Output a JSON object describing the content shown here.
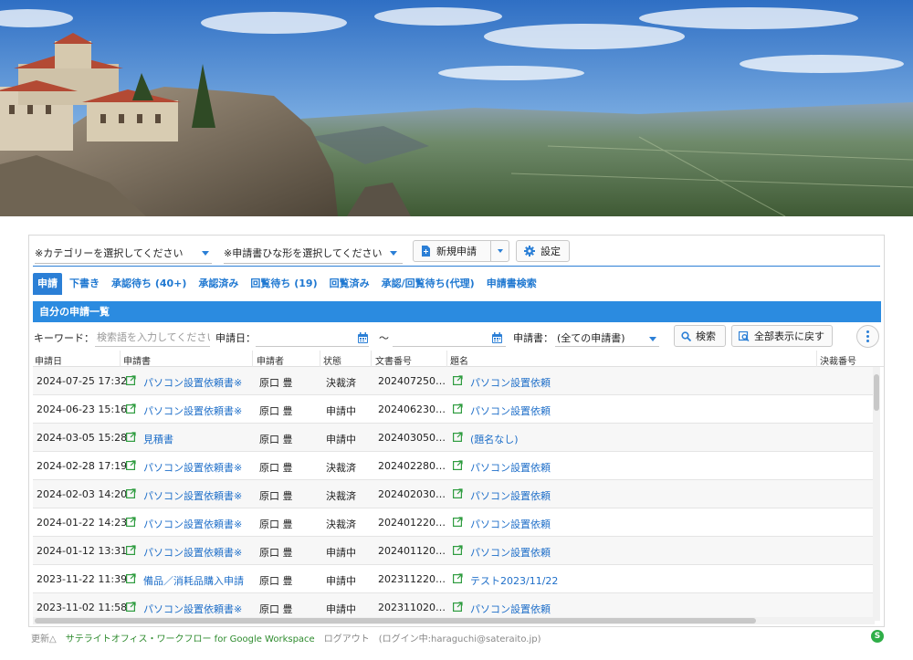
{
  "toolbar": {
    "category_select": "※カテゴリーを選択してください",
    "template_select": "※申請書ひな形を選択してください",
    "new_button": "新規申請",
    "settings_button": "設定"
  },
  "tabs": [
    {
      "label": "申請"
    },
    {
      "label": "下書き"
    },
    {
      "label": "承認待ち (40+)"
    },
    {
      "label": "承認済み"
    },
    {
      "label": "回覧待ち (19)"
    },
    {
      "label": "回覧済み"
    },
    {
      "label": "承認/回覧待ち(代理)"
    },
    {
      "label": "申請書検索"
    }
  ],
  "list_title": "自分の申請一覧",
  "filter": {
    "keyword_label": "キーワード：",
    "keyword_placeholder": "検索語を入力してください",
    "date_label": "申請日：",
    "date_sep": "〜",
    "form_label": "申請書：",
    "form_value": "(全ての申請書)",
    "search_button": "検索",
    "show_all_button": "全部表示に戻す"
  },
  "columns": [
    "申請日",
    "申請書",
    "申請者",
    "状態",
    "文書番号",
    "題名",
    "決裁番号"
  ],
  "rows": [
    {
      "date": "2024-07-25 17:32",
      "form": "パソコン設置依頼書※",
      "user": "原口 豊",
      "status": "決裁済",
      "docno": "202407250…",
      "title": "パソコン設置依頼"
    },
    {
      "date": "2024-06-23 15:16",
      "form": "パソコン設置依頼書※",
      "user": "原口 豊",
      "status": "申請中",
      "docno": "202406230…",
      "title": "パソコン設置依頼"
    },
    {
      "date": "2024-03-05 15:28",
      "form": "見積書",
      "user": "原口 豊",
      "status": "申請中",
      "docno": "202403050…",
      "title": "(題名なし)"
    },
    {
      "date": "2024-02-28 17:19",
      "form": "パソコン設置依頼書※",
      "user": "原口 豊",
      "status": "決裁済",
      "docno": "202402280…",
      "title": "パソコン設置依頼"
    },
    {
      "date": "2024-02-03 14:20",
      "form": "パソコン設置依頼書※",
      "user": "原口 豊",
      "status": "決裁済",
      "docno": "202402030…",
      "title": "パソコン設置依頼"
    },
    {
      "date": "2024-01-22 14:23",
      "form": "パソコン設置依頼書※",
      "user": "原口 豊",
      "status": "決裁済",
      "docno": "202401220…",
      "title": "パソコン設置依頼"
    },
    {
      "date": "2024-01-12 13:31",
      "form": "パソコン設置依頼書※",
      "user": "原口 豊",
      "status": "申請中",
      "docno": "202401120…",
      "title": "パソコン設置依頼"
    },
    {
      "date": "2023-11-22 11:39",
      "form": "備品／消耗品購入申請",
      "user": "原口 豊",
      "status": "申請中",
      "docno": "202311220…",
      "title": "テスト2023/11/22"
    },
    {
      "date": "2023-11-02 11:58",
      "form": "パソコン設置依頼書※",
      "user": "原口 豊",
      "status": "申請中",
      "docno": "202311020…",
      "title": "パソコン設置依頼"
    }
  ],
  "footer": {
    "update": "更新△",
    "product": "サテライトオフィス・ワークフロー for Google Workspace",
    "logout": "ログアウト",
    "login_info": "(ログイン中:haraguchi@sateraito.jp)",
    "badge": "S"
  },
  "colors": {
    "accent": "#2b7fd6",
    "link": "#1f6fc9",
    "green": "#2e8b2e"
  }
}
